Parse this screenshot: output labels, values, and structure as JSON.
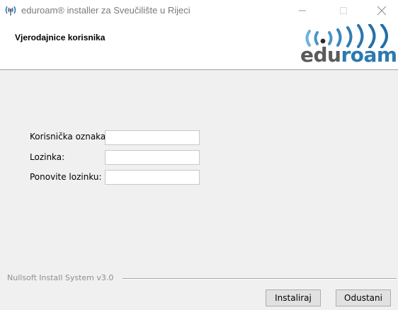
{
  "window": {
    "title": "eduroam® installer za Sveučilište u Rijeci",
    "icon": "eduroam-signal-icon",
    "controls": {
      "minimize": "—",
      "maximize": "☐",
      "close": "✕"
    }
  },
  "header": {
    "title": "Vjerodajnice korisnika",
    "logo": {
      "edu": "edu",
      "roam": "roam",
      "accent_color": "#2b7ab0",
      "gray_color": "#5a5a5a"
    }
  },
  "form": {
    "username": {
      "label": "Korisnička oznaka:",
      "value": ""
    },
    "password": {
      "label": "Lozinka:",
      "value": ""
    },
    "password_repeat": {
      "label": "Ponovite lozinku:",
      "value": ""
    }
  },
  "footer": {
    "branding": "Nullsoft Install System v3.0",
    "install_label": "Instaliraj",
    "cancel_label": "Odustani"
  }
}
